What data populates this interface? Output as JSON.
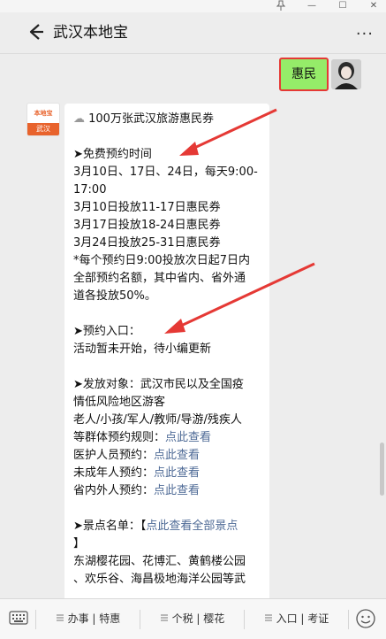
{
  "window": {
    "pin_icon": "pin-icon",
    "controls": [
      "—",
      "☐",
      "✕"
    ]
  },
  "header": {
    "title": "武汉本地宝",
    "back_icon": "back-arrow-icon",
    "more_icon": "more-icon",
    "more_label": "···"
  },
  "chat": {
    "my_message": "惠民",
    "sender_avatar_top": "本地宝",
    "sender_avatar_bottom": "武汉",
    "lines": [
      {
        "pre": "☁",
        "text": " 100万张武汉旅游惠民券",
        "link": ""
      },
      {
        "pre": "",
        "text": "",
        "link": ""
      },
      {
        "pre": "➤",
        "text": "免费预约时间",
        "link": ""
      },
      {
        "pre": "",
        "text": "3月10日、17日、24日，每天9:00-",
        "link": ""
      },
      {
        "pre": "",
        "text": "17:00",
        "link": ""
      },
      {
        "pre": "",
        "text": "3月10日投放11-17日惠民券",
        "link": ""
      },
      {
        "pre": "",
        "text": "3月17日投放18-24日惠民券",
        "link": ""
      },
      {
        "pre": "",
        "text": "3月24日投放25-31日惠民券",
        "link": ""
      },
      {
        "pre": "",
        "text": "*每个预约日9:00投放次日起7日内",
        "link": ""
      },
      {
        "pre": "",
        "text": "全部预约名额，其中省内、省外通",
        "link": ""
      },
      {
        "pre": "",
        "text": "道各投放50%。",
        "link": ""
      },
      {
        "pre": "",
        "text": "",
        "link": ""
      },
      {
        "pre": "➤",
        "text": "预约入口：",
        "link": ""
      },
      {
        "pre": "",
        "text": "活动暂未开始，待小编更新",
        "link": ""
      },
      {
        "pre": "",
        "text": "",
        "link": ""
      },
      {
        "pre": "➤",
        "text": "发放对象：武汉市民以及全国疫",
        "link": ""
      },
      {
        "pre": "",
        "text": "情低风险地区游客",
        "link": ""
      },
      {
        "pre": "",
        "text": "老人/小孩/军人/教师/导游/残疾人",
        "link": ""
      },
      {
        "pre": "",
        "text": "等群体预约规则：",
        "link": "点此查看"
      },
      {
        "pre": "",
        "text": "医护人员预约：",
        "link": "点此查看"
      },
      {
        "pre": "",
        "text": "未成年人预约：",
        "link": "点此查看"
      },
      {
        "pre": "",
        "text": "省内外人预约：",
        "link": "点此查看"
      },
      {
        "pre": "",
        "text": "",
        "link": ""
      },
      {
        "pre": "➤",
        "text": "景点名单：【",
        "link": "点此查看全部景点"
      },
      {
        "pre": "",
        "text": "】",
        "link": ""
      },
      {
        "pre": "",
        "text": "东湖樱花园、花博汇、黄鹤楼公园",
        "link": ""
      },
      {
        "pre": "",
        "text": "、欢乐谷、海昌极地海洋公园等武",
        "link": ""
      }
    ]
  },
  "bottom_menu": {
    "keyboard_icon": "keyboard-icon",
    "items": [
      "办事 | 特惠",
      "个税 | 樱花",
      "入口 | 考证"
    ],
    "menu_icon": "menu-lines-icon",
    "smile_icon": "smile-icon"
  },
  "colors": {
    "my_bubble": "#95ec69",
    "highlight": "#e53935",
    "link": "#4e6a96",
    "arrow": "#e53935"
  }
}
